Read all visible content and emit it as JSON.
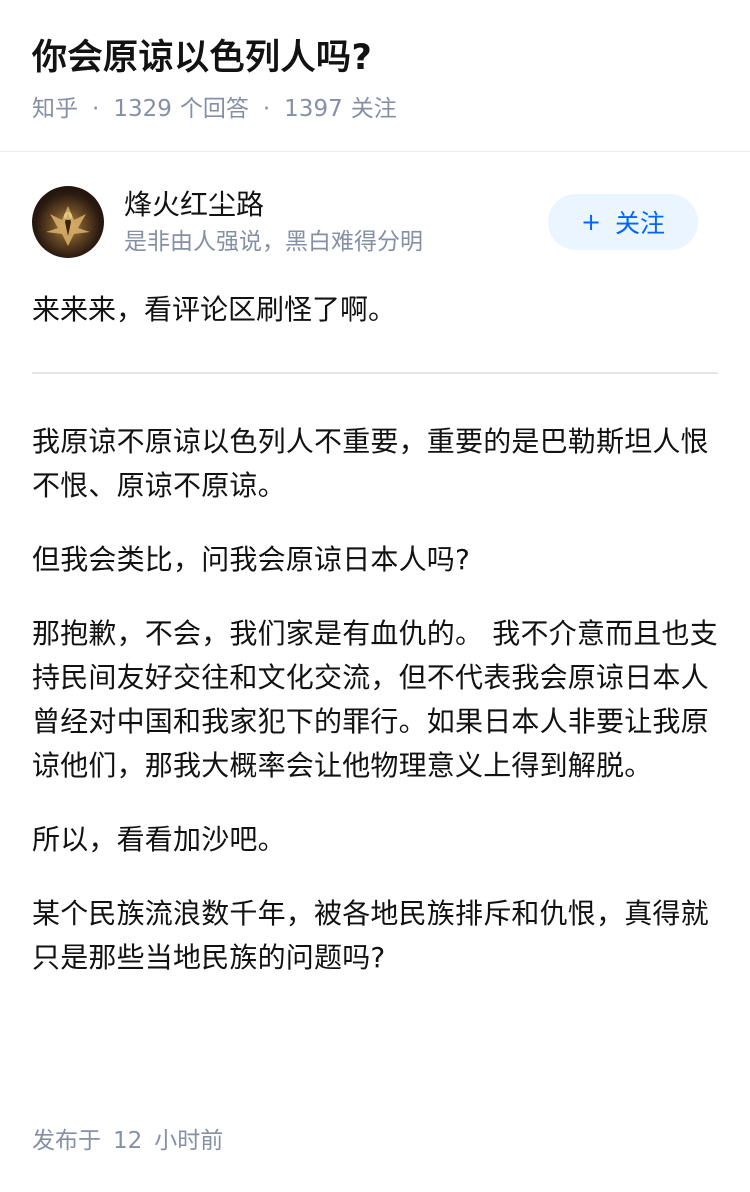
{
  "question": {
    "title": "你会原谅以色列人吗?",
    "source": "知乎",
    "answers_count": "1329",
    "answers_label": "个回答",
    "followers_count": "1397",
    "followers_label": "关注"
  },
  "author": {
    "name": "烽火红尘路",
    "headline": "是非由人强说，黑白难得分明",
    "follow_plus": "+",
    "follow_label": "关注"
  },
  "answer": {
    "intro": "来来来，看评论区刷怪了啊。",
    "paragraphs": [
      "我原谅不原谅以色列人不重要，重要的是巴勒斯坦人恨不恨、原谅不原谅。",
      "但我会类比，问我会原谅日本人吗?",
      "那抱歉，不会，我们家是有血仇的。 我不介意而且也支持民间友好交往和文化交流，但不代表我会原谅日本人曾经对中国和我家犯下的罪行。如果日本人非要让我原谅他们，那我大概率会让他物理意义上得到解脱。",
      "所以，看看加沙吧。",
      "某个民族流浪数千年，被各地民族排斥和仇恨，真得就只是那些当地民族的问题吗?"
    ]
  },
  "footer": {
    "publish_label": "发布于",
    "publish_num": "12",
    "publish_unit": "小时前"
  },
  "colors": {
    "meta_gray": "#8590a6",
    "follow_bg": "#ebf5ff",
    "follow_text": "#0066ff"
  }
}
